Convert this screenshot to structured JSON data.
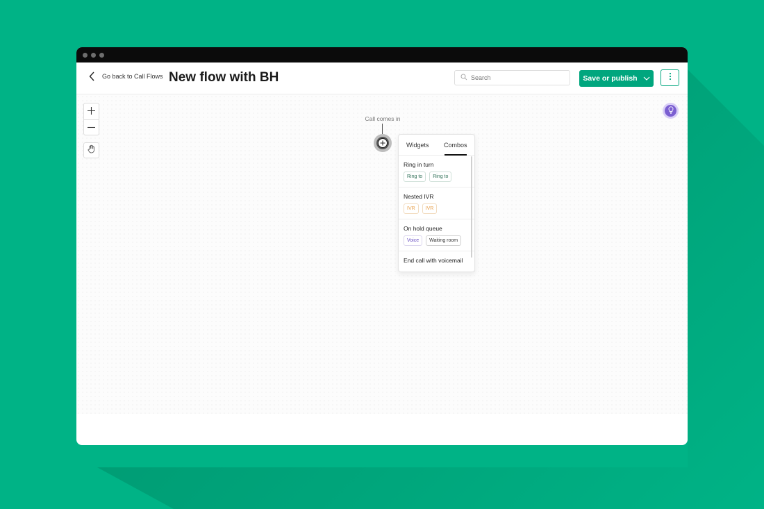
{
  "header": {
    "back_label": "Go back to Call Flows",
    "title": "New flow with BH",
    "search_placeholder": "Search",
    "save_label": "Save or publish"
  },
  "canvas": {
    "start_label": "Call comes in"
  },
  "popover": {
    "tabs": [
      {
        "label": "Widgets",
        "active": false
      },
      {
        "label": "Combos",
        "active": true
      }
    ],
    "combos": [
      {
        "title": "Ring in turn",
        "chips": [
          {
            "label": "Ring to",
            "color": "#2c6e55"
          },
          {
            "label": "Ring to",
            "color": "#2c6e55"
          }
        ]
      },
      {
        "title": "Nested IVR",
        "chips": [
          {
            "label": "IVR",
            "color": "#e8a04a"
          },
          {
            "label": "IVR",
            "color": "#e8a04a"
          }
        ]
      },
      {
        "title": "On hold queue",
        "chips": [
          {
            "label": "Voice",
            "color": "#6a4fc2"
          },
          {
            "label": "Waiting room",
            "color": "#333333"
          }
        ]
      },
      {
        "title": "End call with voicemail",
        "chips": []
      }
    ]
  },
  "colors": {
    "background": "#00b386",
    "accent": "#00a67e",
    "hint": "#7b5fd1"
  },
  "icons": [
    "chevron-left-icon",
    "search-icon",
    "chevron-down-icon",
    "kebab-menu-icon",
    "plus-icon",
    "minus-icon",
    "hand-icon",
    "lightbulb-icon",
    "add-node-icon"
  ]
}
